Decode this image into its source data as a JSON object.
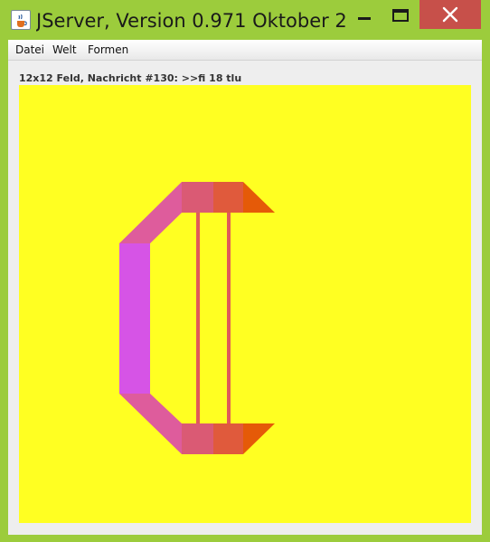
{
  "window": {
    "title": "JServer, Version 0.971 Oktober 2...",
    "buttons": {
      "minimize": "minimize",
      "maximize": "maximize",
      "close": "close"
    },
    "icon": "java-cup-icon"
  },
  "menubar": {
    "items": [
      {
        "label": "Datei"
      },
      {
        "label": "Welt"
      },
      {
        "label": "Formen"
      }
    ]
  },
  "status": {
    "text": "12x12 Feld, Nachricht #130: >>fi 18 tlu"
  },
  "canvas": {
    "background": "#ffff22",
    "shape_colors": [
      "#d654e6",
      "#de5c9c",
      "#e05a3c",
      "#e55a08",
      "#da5a74"
    ]
  }
}
